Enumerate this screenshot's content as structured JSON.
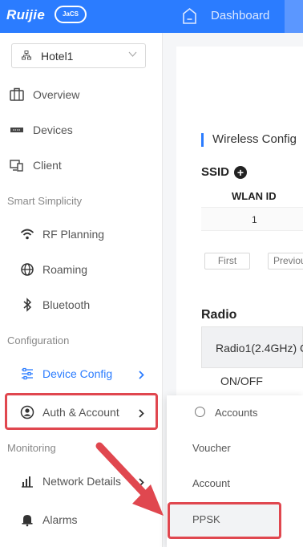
{
  "header": {
    "brand": "Ruijie",
    "brand_badge": "JaCS",
    "dashboard_label": "Dashboard"
  },
  "sidebar": {
    "site_selector": {
      "value": "Hotel1"
    },
    "items": [
      {
        "label": "Overview"
      },
      {
        "label": "Devices"
      },
      {
        "label": "Client"
      }
    ],
    "group_smart": "Smart Simplicity",
    "smart_items": [
      {
        "label": "RF Planning"
      },
      {
        "label": "Roaming"
      },
      {
        "label": "Bluetooth"
      }
    ],
    "group_config": "Configuration",
    "config_items": [
      {
        "label": "Device Config"
      },
      {
        "label": "Auth & Account"
      }
    ],
    "group_monitor": "Monitoring",
    "monitor_items": [
      {
        "label": "Network Details"
      },
      {
        "label": "Alarms"
      }
    ]
  },
  "content": {
    "section_title": "Wireless Config",
    "ssid_label": "SSID",
    "table": {
      "header": "WLAN ID",
      "rows": [
        [
          "1"
        ]
      ]
    },
    "pagination": {
      "first": "First",
      "previous": "Previou"
    },
    "radio_heading": "Radio",
    "radio_tab": "Radio1(2.4GHz) C",
    "onoff_label": "ON/OFF"
  },
  "submenu": {
    "title": "Accounts",
    "items": [
      {
        "label": "Voucher"
      },
      {
        "label": "Account"
      },
      {
        "label": "PPSK"
      }
    ]
  },
  "colors": {
    "brand_blue": "#2b7cff",
    "highlight_red": "#e0474f"
  }
}
